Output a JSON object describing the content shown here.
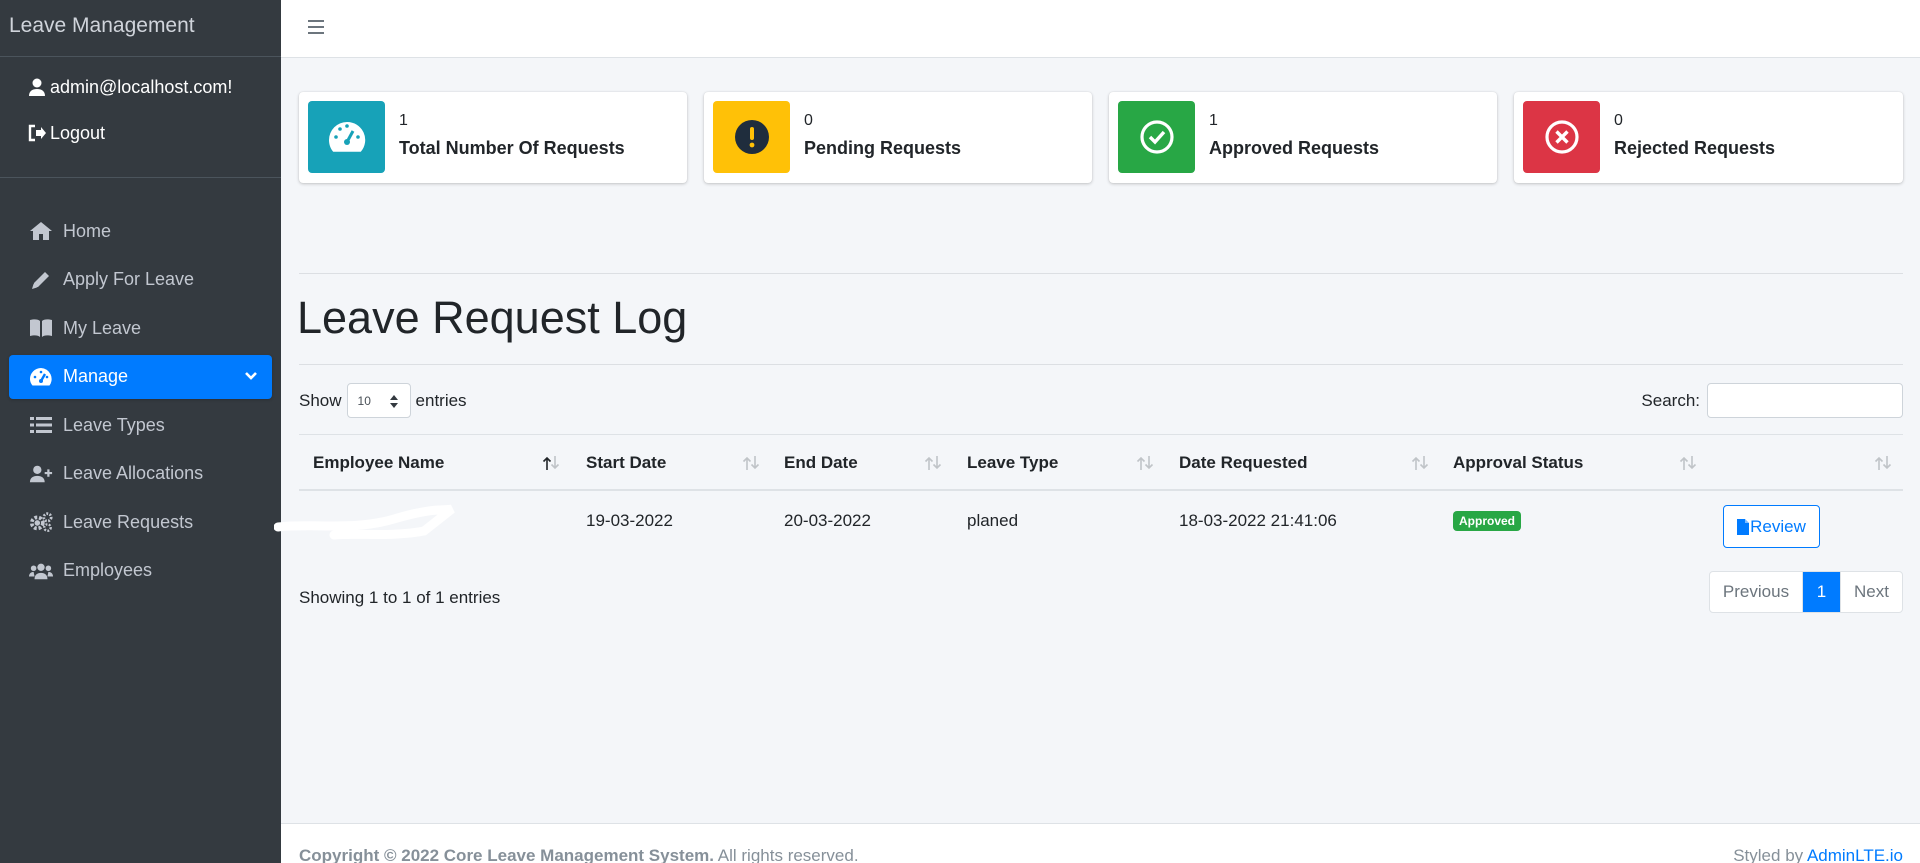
{
  "sidebar": {
    "brand": "Leave Management",
    "user_email": "admin@localhost.com!",
    "logout": "Logout",
    "items": [
      {
        "label": "Home",
        "icon": "home-icon"
      },
      {
        "label": "Apply For Leave",
        "icon": "pencil-icon"
      },
      {
        "label": "My Leave",
        "icon": "book-icon"
      },
      {
        "label": "Manage",
        "icon": "dashboard-icon",
        "active": true
      },
      {
        "label": "Leave Types",
        "icon": "list-icon"
      },
      {
        "label": "Leave Allocations",
        "icon": "user-plus-icon"
      },
      {
        "label": "Leave Requests",
        "icon": "gears-icon"
      },
      {
        "label": "Employees",
        "icon": "users-icon"
      }
    ]
  },
  "stats": [
    {
      "value": "1",
      "label": "Total Number Of Requests",
      "color": "#17a2b8",
      "icon": "gauge-icon"
    },
    {
      "value": "0",
      "label": "Pending Requests",
      "color": "#ffc107",
      "icon": "exclamation-icon"
    },
    {
      "value": "1",
      "label": "Approved Requests",
      "color": "#28a745",
      "icon": "check-circle-icon"
    },
    {
      "value": "0",
      "label": "Rejected Requests",
      "color": "#dc3545",
      "icon": "times-circle-icon"
    }
  ],
  "page": {
    "title": "Leave Request Log"
  },
  "table_controls": {
    "show_label": "Show",
    "entries_value": "10",
    "entries_label": "entries",
    "search_label": "Search:"
  },
  "table": {
    "headers": [
      "Employee Name",
      "Start Date",
      "End Date",
      "Leave Type",
      "Date Requested",
      "Approval Status"
    ],
    "rows": [
      {
        "employee": "",
        "start": "19-03-2022",
        "end": "20-03-2022",
        "type": "planed",
        "requested": "18-03-2022 21:41:06",
        "status": "Approved",
        "action": "Review"
      }
    ]
  },
  "pagination": {
    "info": "Showing 1 to 1 of 1 entries",
    "previous": "Previous",
    "current": "1",
    "next": "Next"
  },
  "footer": {
    "copyright_bold": "Copyright © 2022 Core Leave Management System.",
    "copyright_rest": " All rights reserved.",
    "styled_by": "Styled by ",
    "styled_link": "AdminLTE.io"
  },
  "colors": {
    "primary": "#007bff",
    "sidebar": "#343a40"
  }
}
